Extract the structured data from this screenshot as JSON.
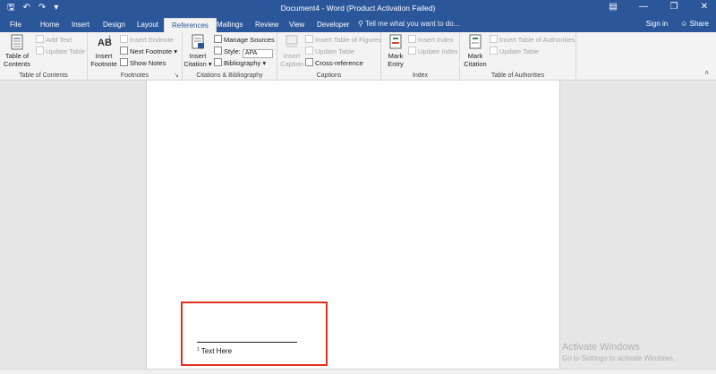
{
  "titlebar": {
    "title": "Document4 - Word (Product Activation Failed)",
    "qat_icons": [
      "save-icon",
      "undo-icon",
      "redo-icon",
      "customize-icon"
    ],
    "window_icons": [
      "ribbon-display-icon",
      "minimize-icon",
      "restore-icon",
      "close-icon"
    ]
  },
  "tabs": [
    {
      "label": "File"
    },
    {
      "label": "Home"
    },
    {
      "label": "Insert"
    },
    {
      "label": "Design"
    },
    {
      "label": "Layout"
    },
    {
      "label": "References",
      "active": true
    },
    {
      "label": "Mailings"
    },
    {
      "label": "Review"
    },
    {
      "label": "View"
    },
    {
      "label": "Developer"
    }
  ],
  "tellme": "Tell me what you want to do...",
  "signin": "Sign in",
  "share": "Share",
  "ribbon": {
    "toc": {
      "group": "Table of Contents",
      "big": "Table of Contents",
      "add_text": "Add Text",
      "update_table": "Update Table"
    },
    "footnotes": {
      "group": "Footnotes",
      "big": "Insert Footnote",
      "insert_endnote": "Insert Endnote",
      "next_footnote": "Next Footnote",
      "show_notes": "Show Notes"
    },
    "citations": {
      "group": "Citations & Bibliography",
      "big": "Insert Citation",
      "manage_sources": "Manage Sources",
      "style_label": "Style:",
      "style_value": "APA",
      "bibliography": "Bibliography"
    },
    "captions": {
      "group": "Captions",
      "big": "Insert Caption",
      "insert_table_of_figures": "Insert Table of Figures",
      "update_table": "Update Table",
      "cross_reference": "Cross-reference"
    },
    "index": {
      "group": "Index",
      "big": "Mark Entry",
      "insert_index": "Insert Index",
      "update_index": "Update Index"
    },
    "toa": {
      "group": "Table of Authorities",
      "big": "Mark Citation",
      "insert_toa": "Insert Table of Authorities",
      "update_table": "Update Table"
    }
  },
  "document": {
    "footnote_number": "1",
    "footnote_text": "Text Here"
  },
  "watermark": {
    "line1": "Activate Windows",
    "line2": "Go to Settings to activate Windows."
  },
  "colors": {
    "accent": "#2b579a",
    "highlight": "#e0301e"
  }
}
